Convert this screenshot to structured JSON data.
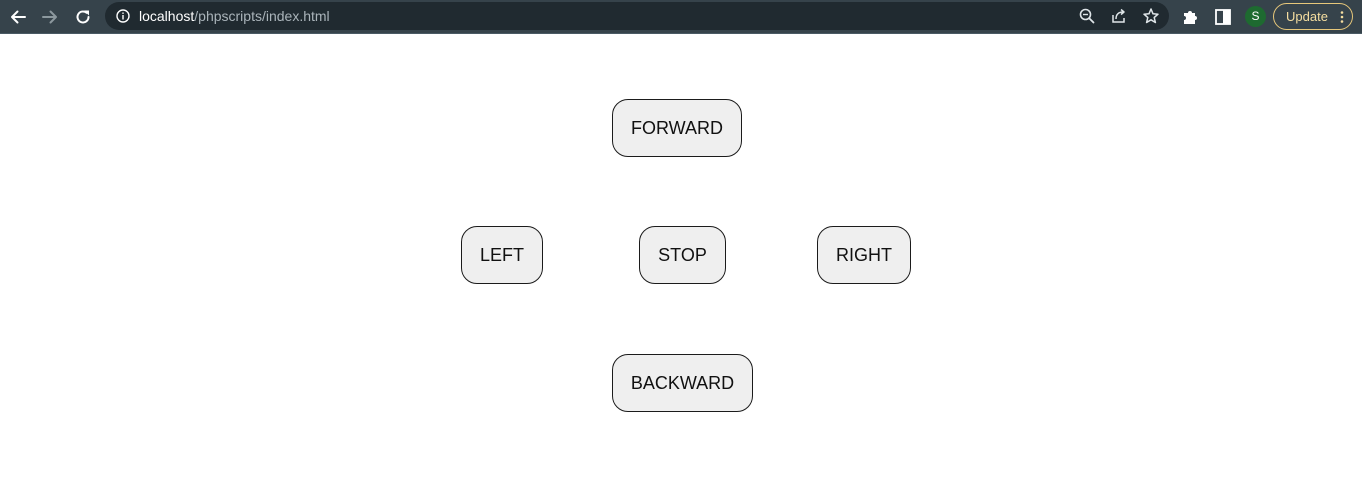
{
  "browser": {
    "url_host": "localhost",
    "url_path": "/phpscripts/index.html",
    "profile_initial": "S",
    "update_label": "Update",
    "icons": [
      "back-arrow-icon",
      "forward-arrow-icon",
      "reload-icon",
      "info-icon",
      "zoom-icon",
      "share-icon",
      "bookmark-star-icon",
      "extensions-puzzle-icon",
      "side-panel-icon",
      "menu-dots-icon"
    ],
    "colors": {
      "toolbar_bg": "#36434b",
      "omnibox_bg": "#202a30",
      "update_accent": "#e6c77a",
      "avatar_bg": "#1e6a30"
    }
  },
  "controls": {
    "forward": "FORWARD",
    "left": "LEFT",
    "stop": "STOP",
    "right": "RIGHT",
    "backward": "BACKWARD",
    "colors": {
      "button_bg": "#efefef",
      "button_border": "#1b1b1b"
    }
  }
}
